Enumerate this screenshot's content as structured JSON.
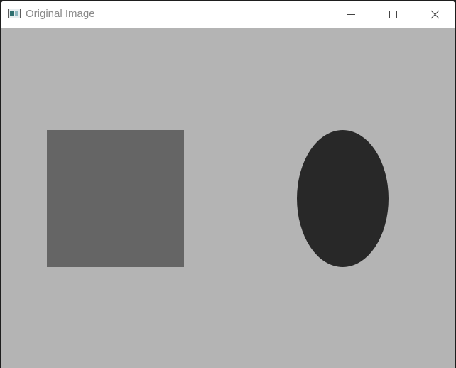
{
  "window": {
    "title": "Original Image",
    "icon": "image-window-icon"
  },
  "titlebar_controls": {
    "minimize_icon": "minimize-icon",
    "maximize_icon": "maximize-icon",
    "close_icon": "close-icon"
  },
  "canvas": {
    "background_color": "#b4b4b4",
    "shapes": [
      {
        "kind": "square",
        "fill": "#656565"
      },
      {
        "kind": "ellipse",
        "fill": "#282828"
      }
    ]
  }
}
